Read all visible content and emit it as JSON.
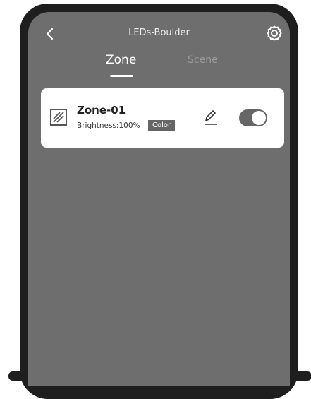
{
  "header": {
    "title": "LEDs-Boulder",
    "back_icon": "chevron-left-icon",
    "settings_icon": "gear-icon"
  },
  "tabs": [
    {
      "label": "Zone",
      "active": true
    },
    {
      "label": "Scene",
      "active": false
    }
  ],
  "zones": [
    {
      "name": "Zone-01",
      "brightness_label": "Brightness:100%",
      "mode_label": "Color",
      "enabled": true
    }
  ],
  "colors": {
    "screen_bg": "#6e6e6e",
    "card_bg": "#ffffff",
    "frame": "#1e1e1e",
    "toggle_on": "#666666"
  }
}
